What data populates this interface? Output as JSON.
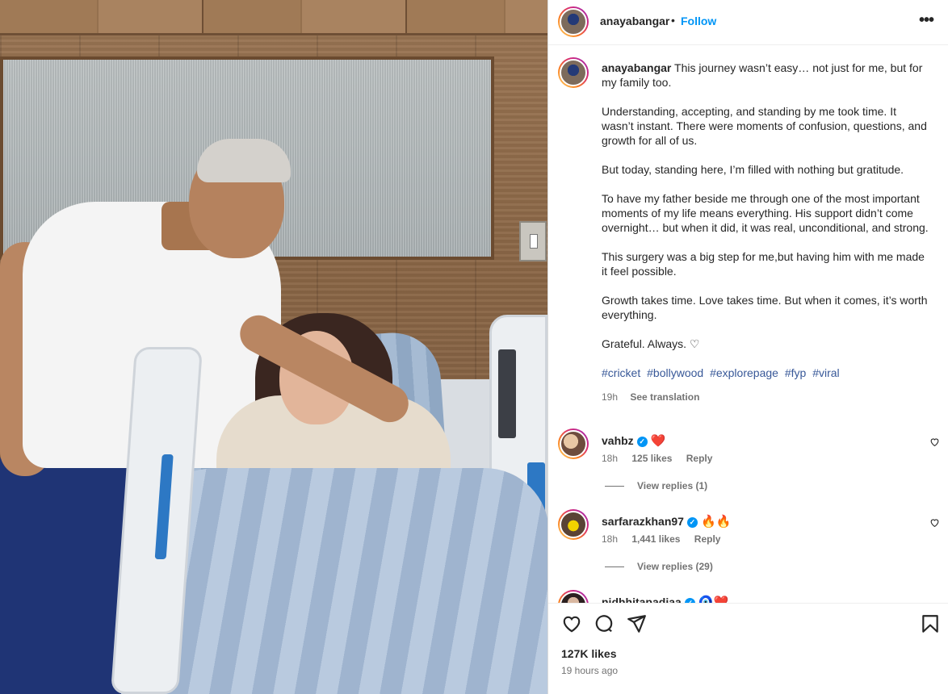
{
  "post": {
    "username": "anayabangar",
    "separator": "•",
    "follow_label": "Follow",
    "more_label": "•••"
  },
  "caption": {
    "username": "anayabangar",
    "lines": [
      "This journey wasn’t easy… not just for me, but for my family too.",
      "Understanding, accepting, and standing by me took time. It wasn’t instant. There were moments of confusion, questions, and growth for all of us.",
      "But today, standing here, I’m filled with nothing but gratitude.",
      "To have my father beside me through one of the most important moments of my life means everything. His support didn’t come overnight… but when it did, it was real, unconditional, and strong.",
      "This surgery was a big step for me,but having him with me made it feel possible.",
      "Growth takes time. Love takes time. But when it comes, it’s worth everything.",
      "Grateful. Always. ♡"
    ],
    "hashtags": [
      "#cricket",
      "#bollywood",
      "#explorepage",
      "#fyp",
      "#viral"
    ],
    "time": "19h",
    "see_translation": "See translation"
  },
  "comments": [
    {
      "username": "vahbz",
      "emoji": "❤️",
      "time": "18h",
      "likes": "125 likes",
      "reply": "Reply",
      "view_replies": "View replies (1)"
    },
    {
      "username": "sarfarazkhan97",
      "emoji": "🔥🔥",
      "time": "18h",
      "likes": "1,441 likes",
      "reply": "Reply",
      "view_replies": "View replies (29)"
    },
    {
      "username": "nidhhitapadiaa",
      "emoji": "🧿❤️",
      "time": "",
      "likes": "",
      "reply": "",
      "view_replies": ""
    }
  ],
  "footer": {
    "likes": "127K likes",
    "time_ago": "19 hours ago"
  },
  "icons": {
    "like": "heart-icon",
    "comment": "comment-icon",
    "share": "share-icon",
    "save": "bookmark-icon"
  }
}
